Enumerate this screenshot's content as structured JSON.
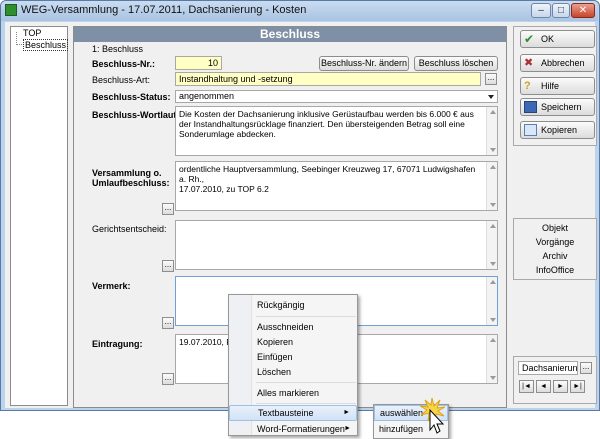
{
  "window": {
    "title": "WEG-Versammlung - 17.07.2011,  Dachsanierung - Kosten",
    "controls": [
      "minimize",
      "maximize",
      "close"
    ]
  },
  "tree": {
    "items": [
      "TOP",
      "Beschluss"
    ]
  },
  "form": {
    "header": "Beschluss",
    "breadcrumb": "1: Beschluss",
    "nr_label": "Beschluss-Nr.:",
    "nr_value": "10",
    "btn_change_nr": "Beschluss-Nr. ändern",
    "btn_delete": "Beschluss löschen",
    "art_label": "Beschluss-Art:",
    "art_value": "Instandhaltung und -setzung",
    "status_label": "Beschluss-Status:",
    "status_value": "angenommen",
    "wortlaut_label": "Beschluss-Wortlaut:",
    "wortlaut_value": "Die Kosten der Dachsanierung inklusive Gerüstaufbau werden bis 6.000 € aus der Instandhaltungsrücklage finanziert. Den übersteigenden Betrag soll eine Sonderumlage abdecken.",
    "versammlung_label_1": "Versammlung o.",
    "versammlung_label_2": "Umlaufbeschluss:",
    "versammlung_value_1": "ordentliche Hauptversammlung, Seebinger Kreuzweg 17, 67071 Ludwigshafen a. Rh.,",
    "versammlung_value_2": "17.07.2010, zu TOP 6.2",
    "gericht_label": "Gerichtsentscheid:",
    "vermerk_label": "Vermerk:",
    "eintragung_label": "Eintragung:",
    "eintragung_value": "19.07.2010, R",
    "dots": "..."
  },
  "right_panel": {
    "ok": "OK",
    "abbrechen": "Abbrechen",
    "hilfe": "Hilfe",
    "speichern": "Speichern",
    "kopieren": "Kopieren",
    "links": [
      "Objekt",
      "Vorgänge",
      "Archiv",
      "InfoOffice"
    ],
    "nav_field": "Dachsanierun",
    "nav_buttons": [
      "|◄",
      "◄",
      "►",
      "►|"
    ]
  },
  "context_menu": {
    "undo": "Rückgängig",
    "cut": "Ausschneiden",
    "copy": "Kopieren",
    "paste": "Einfügen",
    "delete": "Löschen",
    "select_all": "Alles markieren",
    "textbausteine": "Textbausteine",
    "word_format": "Word-Formatierungen",
    "submenu_arrow": "►"
  },
  "submenu": {
    "select": "auswählen",
    "add": "hinzufügen"
  },
  "colors": {
    "header": "#7f8fa6",
    "yellow_field": "#ffffc4",
    "menu_highlight": "#d2e3f6"
  }
}
